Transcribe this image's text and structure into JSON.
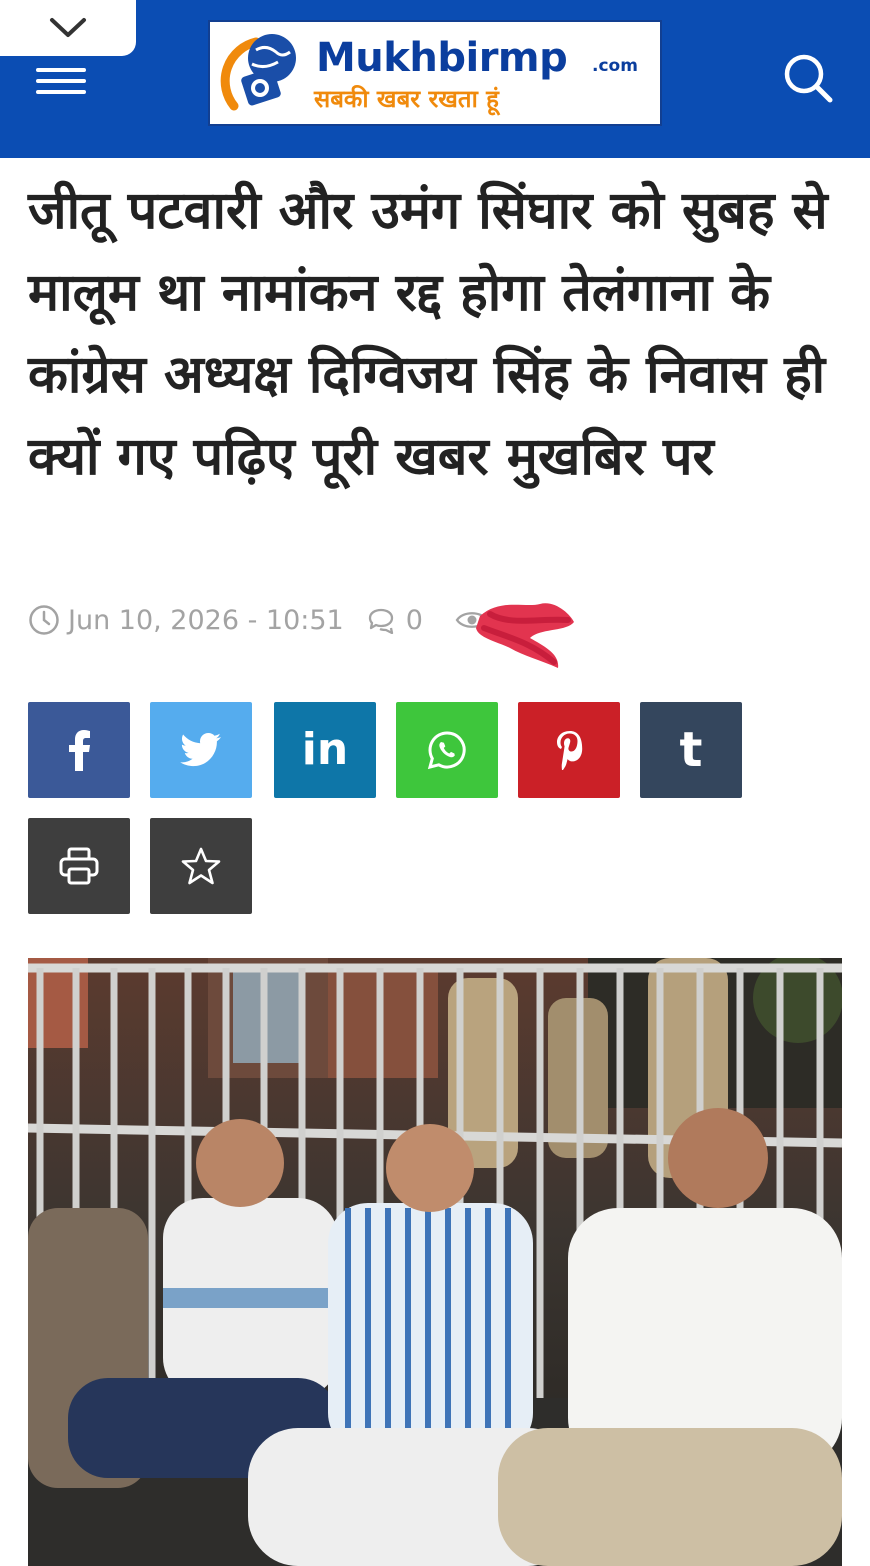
{
  "header": {
    "logo": {
      "name": "Mukhbirmp",
      "suffix": ".com",
      "tagline": "सबकी खबर रखता हूं"
    },
    "collapse_icon": "chevron-down-icon",
    "menu_icon": "hamburger-menu-icon",
    "search_icon": "search-icon",
    "bg_color": "#0b4db3"
  },
  "article": {
    "title": "जीतू पटवारी और उमंग सिंघार को सुबह से मालूम था नामांकन रद्द होगा तेलंगाना के कांग्रेस अध्यक्ष दिग्विजय सिंह के निवास ही क्यों गए पढ़िए पूरी खबर मुखबिर पर",
    "meta": {
      "datetime": "Jun 10, 2026 - 10:51",
      "comments": "0"
    }
  },
  "share": [
    {
      "name": "facebook",
      "glyph": "f",
      "color": "#3b5998"
    },
    {
      "name": "twitter",
      "glyph": "twitter-bird",
      "color": "#55acee"
    },
    {
      "name": "linkedin",
      "glyph": "in",
      "color": "#0e76a8"
    },
    {
      "name": "whatsapp",
      "glyph": "whatsapp",
      "color": "#3ec63c"
    },
    {
      "name": "pinterest",
      "glyph": "p",
      "color": "#cb2027"
    },
    {
      "name": "tumblr",
      "glyph": "t",
      "color": "#34465d"
    },
    {
      "name": "print",
      "glyph": "printer-icon",
      "color": "#3e3e3e"
    },
    {
      "name": "favorite",
      "glyph": "star-icon",
      "color": "#3e3e3e"
    }
  ],
  "featured_image": "photo of four men seated on the ground in front of an iron gate at night, police officers standing behind"
}
